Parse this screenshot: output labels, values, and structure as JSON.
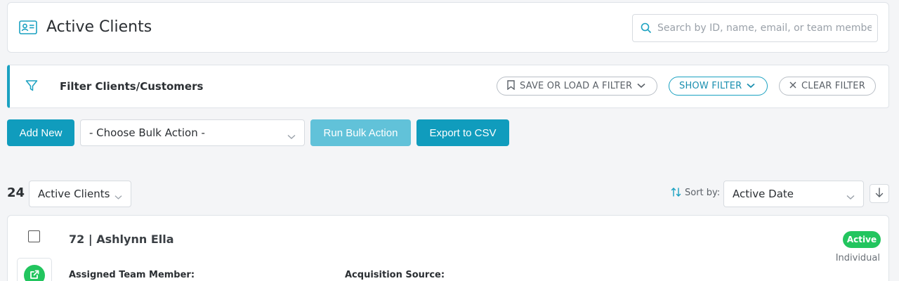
{
  "header": {
    "title": "Active Clients",
    "title_icon": "id-card-icon",
    "search_placeholder": "Search by ID, name, email, or team member..."
  },
  "filter_bar": {
    "title": "Filter Clients/Customers",
    "save_load_label": "SAVE OR LOAD A FILTER",
    "show_filter_label": "SHOW FILTER",
    "clear_filter_label": "CLEAR FILTER"
  },
  "actions": {
    "add_new_label": "Add New",
    "bulk_action_selected": "- Choose Bulk Action -",
    "run_bulk_label": "Run Bulk Action",
    "export_label": "Export to CSV"
  },
  "listing": {
    "count": "24",
    "status_selected": "Active Clients",
    "sort_by_label": "Sort by:",
    "sort_selected": "Active Date"
  },
  "clients": [
    {
      "name": "72 | Ashlynn Ella",
      "status": "Active",
      "type": "Individual",
      "assigned_label": "Assigned Team Member:",
      "source_label": "Acquisition Source:"
    }
  ],
  "colors": {
    "accent": "#109cbd",
    "accent_light": "#61c2d9",
    "status_active": "#22c55e"
  }
}
